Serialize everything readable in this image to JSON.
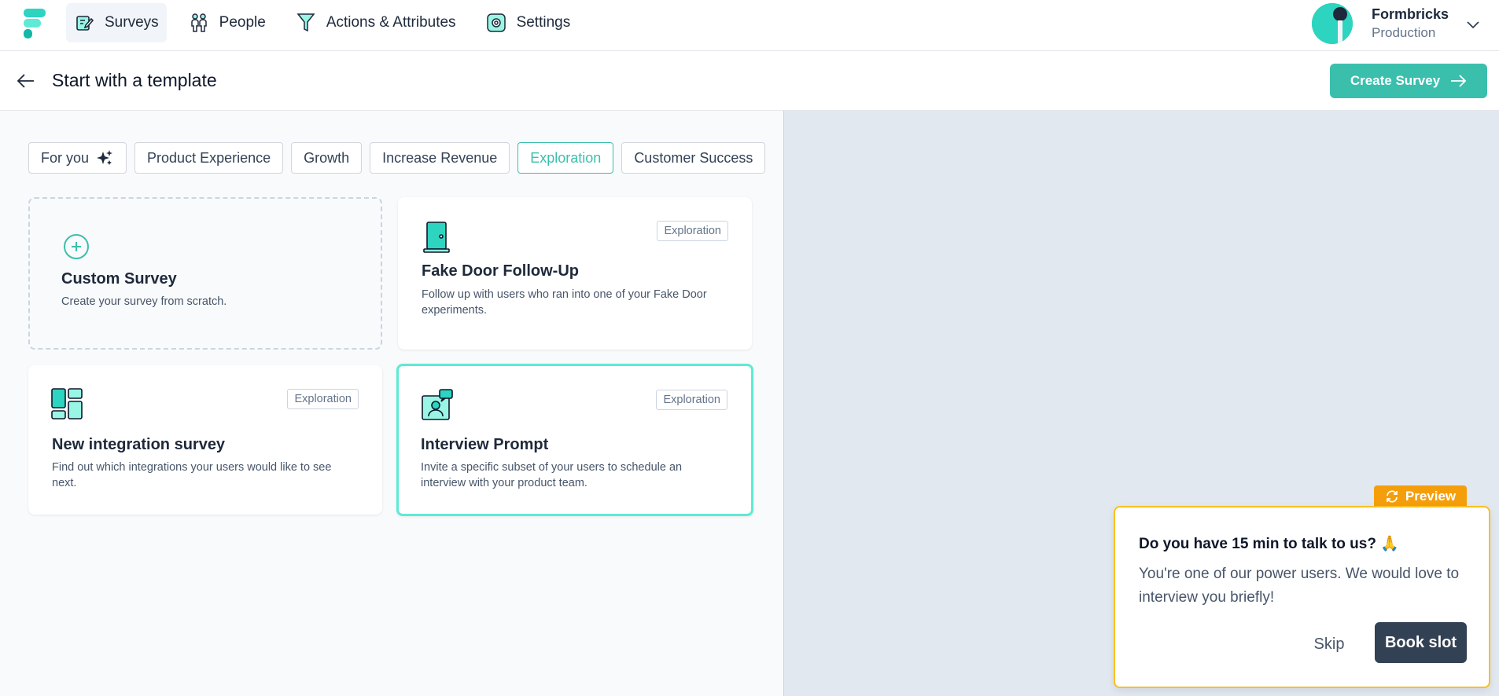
{
  "nav": {
    "items": [
      {
        "label": "Surveys",
        "icon": "survey-pen-icon",
        "active": true
      },
      {
        "label": "People",
        "icon": "people-icon",
        "active": false
      },
      {
        "label": "Actions & Attributes",
        "icon": "filter-funnel-icon",
        "active": false
      },
      {
        "label": "Settings",
        "icon": "gear-icon",
        "active": false
      }
    ],
    "org_name": "Formbricks",
    "org_env": "Production"
  },
  "header": {
    "title": "Start with a template",
    "create_label": "Create Survey"
  },
  "filters": [
    {
      "label": "For you",
      "icon": "sparkles-icon",
      "active": false
    },
    {
      "label": "Product Experience",
      "active": false
    },
    {
      "label": "Growth",
      "active": false
    },
    {
      "label": "Increase Revenue",
      "active": false
    },
    {
      "label": "Exploration",
      "active": true
    },
    {
      "label": "Customer Success",
      "active": false
    }
  ],
  "templates": [
    {
      "title": "Custom Survey",
      "description": "Create your survey from scratch.",
      "icon": "plus-circle-icon"
    },
    {
      "title": "Fake Door Follow-Up",
      "description": "Follow up with users who ran into one of your Fake Door experiments.",
      "tag": "Exploration",
      "icon": "door-icon"
    },
    {
      "title": "New integration survey",
      "description": "Find out which integrations your users would like to see next.",
      "tag": "Exploration",
      "icon": "layout-grid-icon"
    },
    {
      "title": "Interview Prompt",
      "description": "Invite a specific subset of your users to schedule an interview with your product team.",
      "tag": "Exploration",
      "icon": "interview-icon"
    }
  ],
  "preview": {
    "badge": "Preview",
    "question": "Do you have 15 min to talk to us? 🙏",
    "subheader": "You're one of our power users. We would love to interview you briefly!",
    "skip_label": "Skip",
    "book_label": "Book slot"
  },
  "colors": {
    "brand": "#3bbfad",
    "preview_accent": "#f59e0b",
    "dark_button": "#334155"
  }
}
